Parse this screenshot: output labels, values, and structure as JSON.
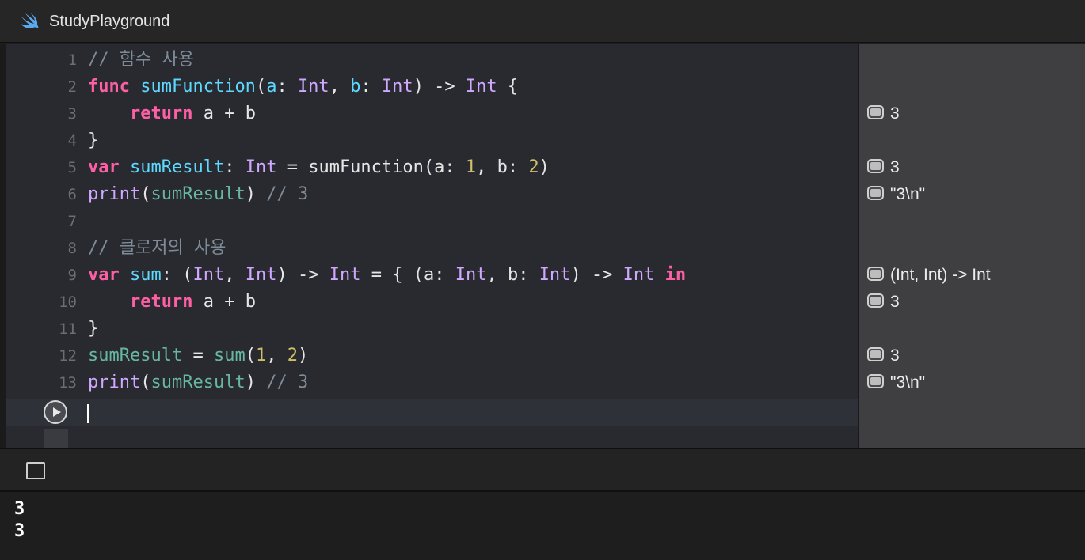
{
  "window": {
    "title": "StudyPlayground"
  },
  "editor": {
    "line_numbers": [
      "1",
      "2",
      "3",
      "4",
      "5",
      "6",
      "7",
      "8",
      "9",
      "10",
      "11",
      "12",
      "13"
    ],
    "lines": {
      "l1": {
        "comment": "// 함수 사용"
      },
      "l2": {
        "kw_func": "func",
        "fn_name": "sumFunction",
        "p1": "(",
        "a": "a",
        "c1": ": ",
        "t1": "Int",
        "comma1": ", ",
        "b": "b",
        "c2": ": ",
        "t2": "Int",
        "arrow": ") -> ",
        "t3": "Int",
        "brace": " {"
      },
      "l3": {
        "indent": "    ",
        "kw_return": "return",
        "expr": " a + b"
      },
      "l4": {
        "text": "}"
      },
      "l5": {
        "kw_var": "var",
        "sp": " ",
        "name": "sumResult",
        "colon": ": ",
        "type": "Int",
        "eq": " = sumFunction(a: ",
        "n1": "1",
        "mid": ", b: ",
        "n2": "2",
        "close": ")"
      },
      "l6": {
        "print": "print",
        "open": "(",
        "arg": "sumResult",
        "close": ") ",
        "comment": "// 3"
      },
      "l7": {
        "text": ""
      },
      "l8": {
        "comment": "// 클로저의 사용"
      },
      "l9": {
        "kw_var": "var",
        "sp": " ",
        "name": "sum",
        "sig_open": ": (",
        "t1": "Int",
        "comma": ", ",
        "t2": "Int",
        "arrow1": ") -> ",
        "t3": "Int",
        "eq": " = { (a: ",
        "t4": "Int",
        "b": ", b: ",
        "t5": "Int",
        "arrow2": ") -> ",
        "t6": "Int",
        "sp2": " ",
        "kw_in": "in"
      },
      "l10": {
        "indent": "    ",
        "kw_return": "return",
        "expr": " a + b"
      },
      "l11": {
        "text": "}"
      },
      "l12": {
        "name": "sumResult",
        "eq": " = ",
        "call": "sum",
        "open": "(",
        "n1": "1",
        "comma": ", ",
        "n2": "2",
        "close": ")"
      },
      "l13": {
        "print": "print",
        "open": "(",
        "arg": "sumResult",
        "close": ") ",
        "comment": "// 3"
      }
    }
  },
  "results": {
    "r3": "3",
    "r5": "3",
    "r6": "\"3\\n\"",
    "r9": "(Int, Int) -> Int",
    "r10": "3",
    "r12": "3",
    "r13": "\"3\\n\""
  },
  "console": {
    "output": [
      "3",
      "3"
    ]
  },
  "colors": {
    "keyword": "#fc5fa3",
    "type": "#d0a8ff",
    "function": "#67b7a4",
    "declared_function": "#5dd8ff",
    "number": "#d0bf69",
    "comment": "#7f8c98"
  },
  "icons": {
    "title_icon": "swift-logo-icon",
    "run": "play-icon",
    "result": "quick-look-icon",
    "console_toggle": "console-toggle-icon"
  }
}
